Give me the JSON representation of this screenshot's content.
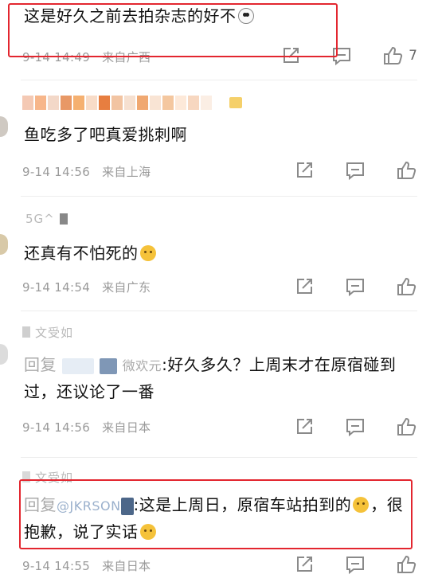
{
  "comments": [
    {
      "content": "这是好久之前去拍杂志的好不",
      "date": "9-14 14:49",
      "location": "来自广西",
      "like_count": "7"
    },
    {
      "username_hidden": "",
      "content": "鱼吃多了吧真爱挑刺啊",
      "date": "9-14 14:56",
      "location": "来自上海"
    },
    {
      "username": "5G^",
      "content": "还真有不怕死的",
      "date": "9-14 14:54",
      "location": "来自广东"
    },
    {
      "username": "文受如",
      "reply_prefix": "回复",
      "reply_target_fragment": "微欢元",
      "content": ":好久多久？上周末才在原宿碰到过，还议论了一番",
      "date": "9-14 14:56",
      "location": "来自日本"
    },
    {
      "username": "文受如",
      "reply_prefix": "回复",
      "reply_target_fragment": "@JKRSON",
      "content_part1": ":这是上周日，原宿车站拍到的",
      "content_part2": "，很抱歉，说了实话",
      "date": "9-14 14:55",
      "location": "来自日本"
    }
  ],
  "colors": {
    "highlight_border": "#e3262f",
    "meta_text": "#9a9a9a",
    "icon_stroke": "#8a8a8a"
  },
  "icons": [
    "share-icon",
    "comment-icon",
    "like-icon"
  ]
}
